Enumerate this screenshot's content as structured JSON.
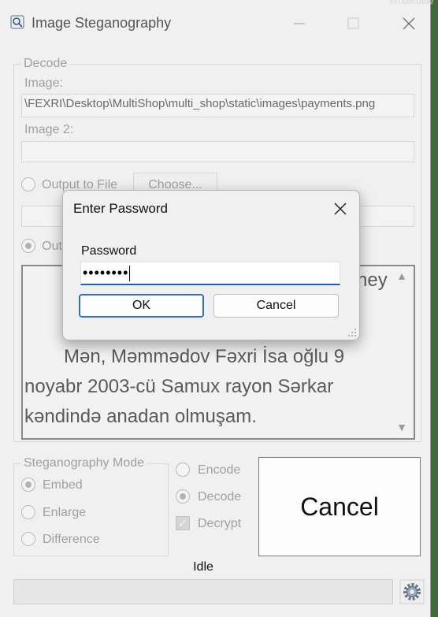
{
  "window": {
    "title": "Image Steganography",
    "topright_text": "Erudecaide"
  },
  "decode": {
    "group_title": "Decode",
    "image_label": "Image:",
    "image_path": "\\FEXRI\\Desktop\\MultiShop\\multi_shop\\static\\images\\payments.png",
    "image2_label": "Image 2:",
    "image2_path": "",
    "output_to_file_label": "Output to File",
    "choose_label": "Choose...",
    "output_path": "",
    "output_text_label": "Out",
    "output_text_partial": "ney",
    "output_lines": [
      "Mən, Məmmədov Fəxri İsa oğlu 9",
      "noyabr 2003-cü Samux rayon Sərkar",
      "kəndində anadan olmuşam."
    ]
  },
  "mode": {
    "group_title": "Steganography Mode",
    "options": [
      "Embed",
      "Enlarge",
      "Difference"
    ],
    "selected": "Embed"
  },
  "operation": {
    "encode_label": "Encode",
    "decode_label": "Decode",
    "selected": "Decode",
    "decrypt_label": "Decrypt",
    "decrypt_checked": true
  },
  "cancel_label": "Cancel",
  "status": "Idle",
  "progress": 0,
  "dialog": {
    "title": "Enter Password",
    "password_label": "Password",
    "password_value": "••••••••",
    "ok_label": "OK",
    "cancel_label": "Cancel"
  },
  "colors": {
    "accent": "#2f6fcb",
    "desktop": "#3f6a3a"
  }
}
